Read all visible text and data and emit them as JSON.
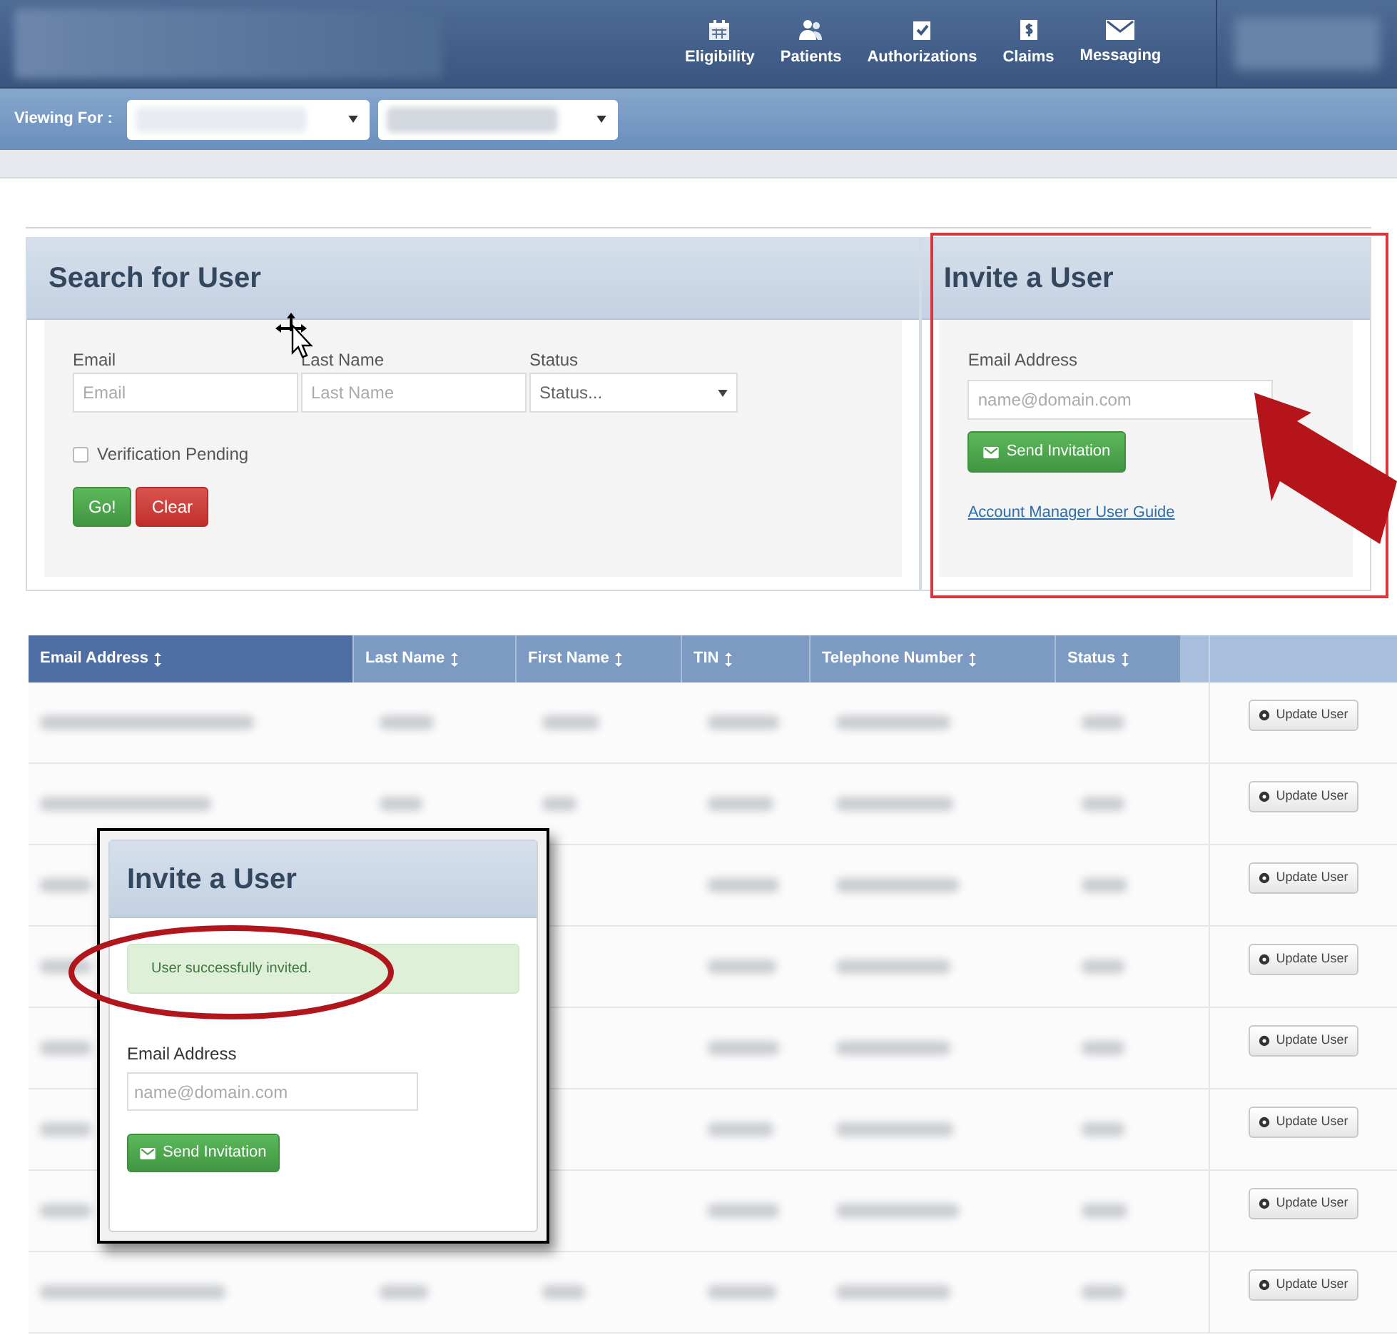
{
  "nav": {
    "items": [
      {
        "label": "Eligibility",
        "kind": "calendar"
      },
      {
        "label": "Patients",
        "kind": "people"
      },
      {
        "label": "Authorizations",
        "kind": "check"
      },
      {
        "label": "Claims",
        "kind": "dollar"
      },
      {
        "label": "Messaging",
        "kind": "mail"
      }
    ]
  },
  "viewing_for": {
    "label": "Viewing For :"
  },
  "search_panel": {
    "title": "Search for User",
    "fields": [
      {
        "label": "Email",
        "placeholder": "Email",
        "kind": "text"
      },
      {
        "label": "Last Name",
        "placeholder": "Last Name",
        "kind": "text"
      },
      {
        "label": "Status",
        "value": "Status...",
        "kind": "select"
      }
    ],
    "checkbox": {
      "label": "Verification Pending",
      "checked": false
    },
    "buttons": [
      {
        "label": "Go!",
        "kind": "success"
      },
      {
        "label": "Clear",
        "kind": "danger"
      }
    ]
  },
  "invite_panel": {
    "title": "Invite a User",
    "field_label": "Email Address",
    "placeholder": "name@domain.com",
    "button": "Send Invitation",
    "link": "Account Manager User Guide"
  },
  "table": {
    "columns": [
      {
        "label": "Email Address",
        "selected": true
      },
      {
        "label": "Last Name",
        "selected": false
      },
      {
        "label": "First Name",
        "selected": false
      },
      {
        "label": "TIN",
        "selected": false
      },
      {
        "label": "Telephone Number",
        "selected": false
      },
      {
        "label": "Status",
        "selected": false
      }
    ],
    "rows": [
      {
        "action": "Update User"
      },
      {
        "action": "Update User"
      },
      {
        "action": "Update User"
      },
      {
        "action": "Update User"
      },
      {
        "action": "Update User"
      },
      {
        "action": "Update User"
      },
      {
        "action": "Update User"
      },
      {
        "action": "Update User"
      }
    ]
  },
  "inset": {
    "title": "Invite a User",
    "alert": "User successfully invited.",
    "field_label": "Email Address",
    "placeholder": "name@domain.com",
    "button": "Send Invitation"
  }
}
